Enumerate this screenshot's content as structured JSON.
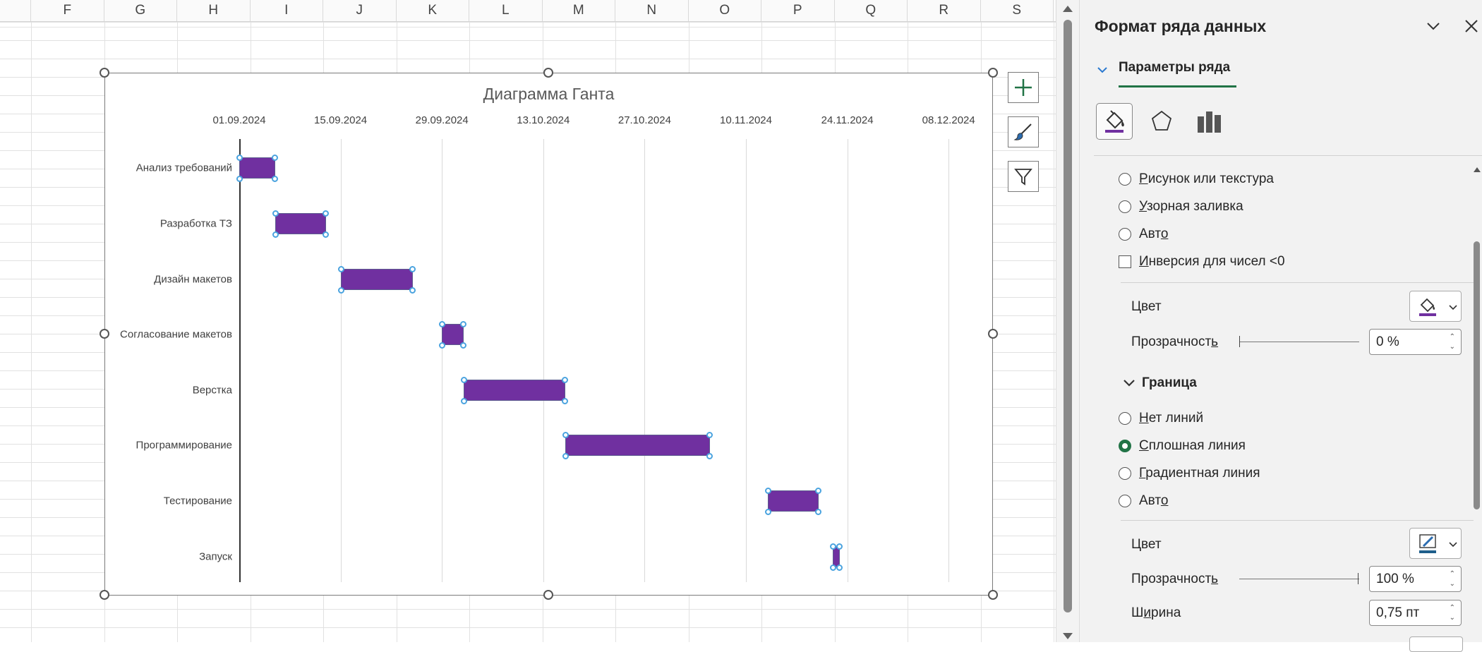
{
  "sheet": {
    "columns": [
      "F",
      "G",
      "H",
      "I",
      "J",
      "K",
      "L",
      "M",
      "N",
      "O",
      "P",
      "Q",
      "R",
      "S"
    ]
  },
  "chart": {
    "title": "Диаграмма Ганта",
    "bar_color": "#7030a0",
    "date_labels": [
      "01.09.2024",
      "15.09.2024",
      "29.09.2024",
      "13.10.2024",
      "27.10.2024",
      "10.11.2024",
      "24.11.2024",
      "08.12.2024"
    ],
    "tasks": [
      "Анализ требований",
      "Разработка ТЗ",
      "Дизайн макетов",
      "Согласование макетов",
      "Верстка",
      "Программирование",
      "Тестирование",
      "Запуск"
    ],
    "buttons": [
      "chart-elements",
      "chart-styles",
      "chart-filters"
    ]
  },
  "chart_data": {
    "type": "bar",
    "title": "Диаграмма Ганта",
    "x_axis": "date",
    "xlim": [
      "01.09.2024",
      "15.12.2024"
    ],
    "x_ticks": [
      "01.09.2024",
      "15.09.2024",
      "29.09.2024",
      "13.10.2024",
      "27.10.2024",
      "10.11.2024",
      "24.11.2024",
      "08.12.2024"
    ],
    "categories": [
      "Анализ требований",
      "Разработка ТЗ",
      "Дизайн макетов",
      "Согласование макетов",
      "Верстка",
      "Программирование",
      "Тестирование",
      "Запуск"
    ],
    "series": [
      {
        "start": [
          "01.09.2024",
          "06.09.2024",
          "15.09.2024",
          "29.09.2024",
          "02.10.2024",
          "16.10.2024",
          "13.11.2024",
          "22.11.2024"
        ],
        "duration_days": [
          5,
          7,
          10,
          3,
          14,
          20,
          7,
          1
        ]
      }
    ],
    "grid": true,
    "legend": "none",
    "color": "#7030a0"
  },
  "pane": {
    "title": "Формат ряда данных",
    "tab_label": "Параметры ряда",
    "icons": [
      "fill-line-icon",
      "effects-icon",
      "series-options-icon"
    ],
    "fill": {
      "options": [
        {
          "pre": "",
          "u": "Р",
          "post": "исунок или текстура"
        },
        {
          "pre": "",
          "u": "У",
          "post": "зорная заливка"
        },
        {
          "pre": "Авт",
          "u": "о",
          "post": ""
        }
      ],
      "invert": {
        "pre": "",
        "u": "И",
        "post": "нверсия для чисел <0"
      },
      "color_label": "Цвет",
      "transparency_label": {
        "pre": "Прозрачност",
        "u": "ь",
        "post": ""
      },
      "transparency_value": "0 %"
    },
    "border": {
      "section_label": "Граница",
      "options": [
        {
          "pre": "",
          "u": "Н",
          "post": "ет линий",
          "selected": false
        },
        {
          "pre": "",
          "u": "С",
          "post": "плошная линия",
          "selected": true
        },
        {
          "pre": "",
          "u": "Г",
          "post": "радиентная линия",
          "selected": false
        },
        {
          "pre": "Авт",
          "u": "о",
          "post": "",
          "selected": false
        }
      ],
      "color_label": "Цвет",
      "transparency_label": {
        "pre": "Прозрачност",
        "u": "ь",
        "post": ""
      },
      "transparency_value": "100 %",
      "width_label": {
        "pre": "Ш",
        "u": "и",
        "post": "рина"
      },
      "width_value": "0,75 пт"
    },
    "accent_color": "#217346"
  }
}
